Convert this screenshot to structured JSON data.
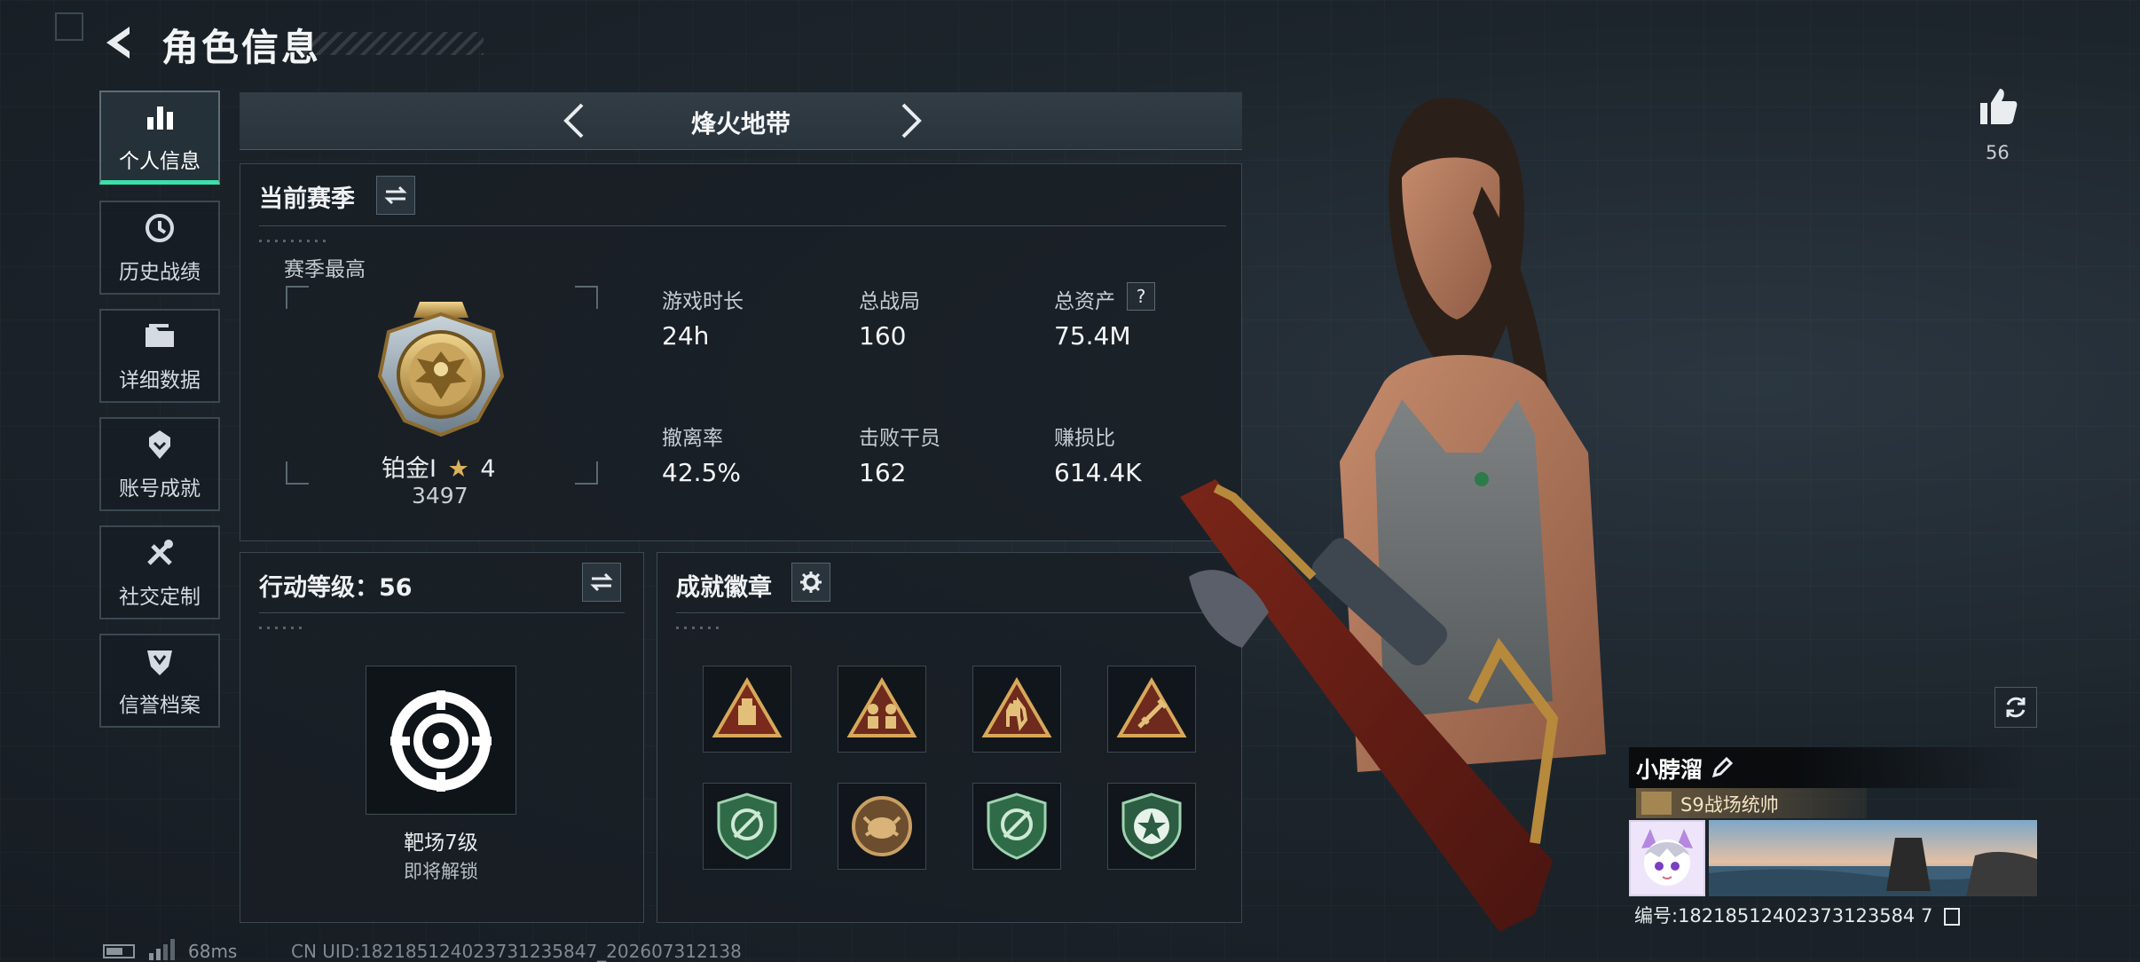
{
  "header": {
    "title": "角色信息",
    "back_icon": "back-arrow-icon"
  },
  "sidebar": {
    "items": [
      {
        "label": "个人信息",
        "icon": "bar-chart-icon",
        "active": true
      },
      {
        "label": "历史战绩",
        "icon": "history-clock-icon",
        "active": false
      },
      {
        "label": "详细数据",
        "icon": "folder-icon",
        "active": false
      },
      {
        "label": "账号成就",
        "icon": "achievement-badge-icon",
        "active": false
      },
      {
        "label": "社交定制",
        "icon": "tools-icon",
        "active": false
      },
      {
        "label": "信誉档案",
        "icon": "shield-emblem-icon",
        "active": false
      }
    ]
  },
  "map_selector": {
    "label": "烽火地带"
  },
  "season": {
    "title": "当前赛季",
    "subtitle": "赛季最高",
    "rank_name": "铂金Ⅰ",
    "rank_stars": "4",
    "rank_score": "3497",
    "stats": [
      {
        "label": "游戏时长",
        "value": "24h"
      },
      {
        "label": "总战局",
        "value": "160"
      },
      {
        "label": "总资产",
        "value": "75.4M",
        "help": "?"
      },
      {
        "label": "撤离率",
        "value": "42.5%"
      },
      {
        "label": "击败干员",
        "value": "162"
      },
      {
        "label": "赚损比",
        "value": "614.4K"
      }
    ]
  },
  "action_level": {
    "title": "行动等级：56",
    "target_label": "靶场7级",
    "target_status": "即将解锁"
  },
  "achievements": {
    "title": "成就徽章",
    "badges": [
      "triangle-supply-badge",
      "triangle-soldiers-badge",
      "triangle-hand-badge",
      "triangle-sword-badge",
      "green-shield-badge",
      "bronze-crab-badge",
      "green-shield-badge",
      "green-star-badge"
    ]
  },
  "profile": {
    "likes": "56",
    "name": "小脖溜",
    "title_badge": "S9战场统帅",
    "id_line": "编号:18218512402373123584 7"
  },
  "status_bar": {
    "ping": "68ms",
    "cn_uid": "CN UID:182185124023731235847_202607312138"
  },
  "colors": {
    "accent": "#3be0a8",
    "panel_border": "#3b4852",
    "gold": "#c9a45c"
  }
}
